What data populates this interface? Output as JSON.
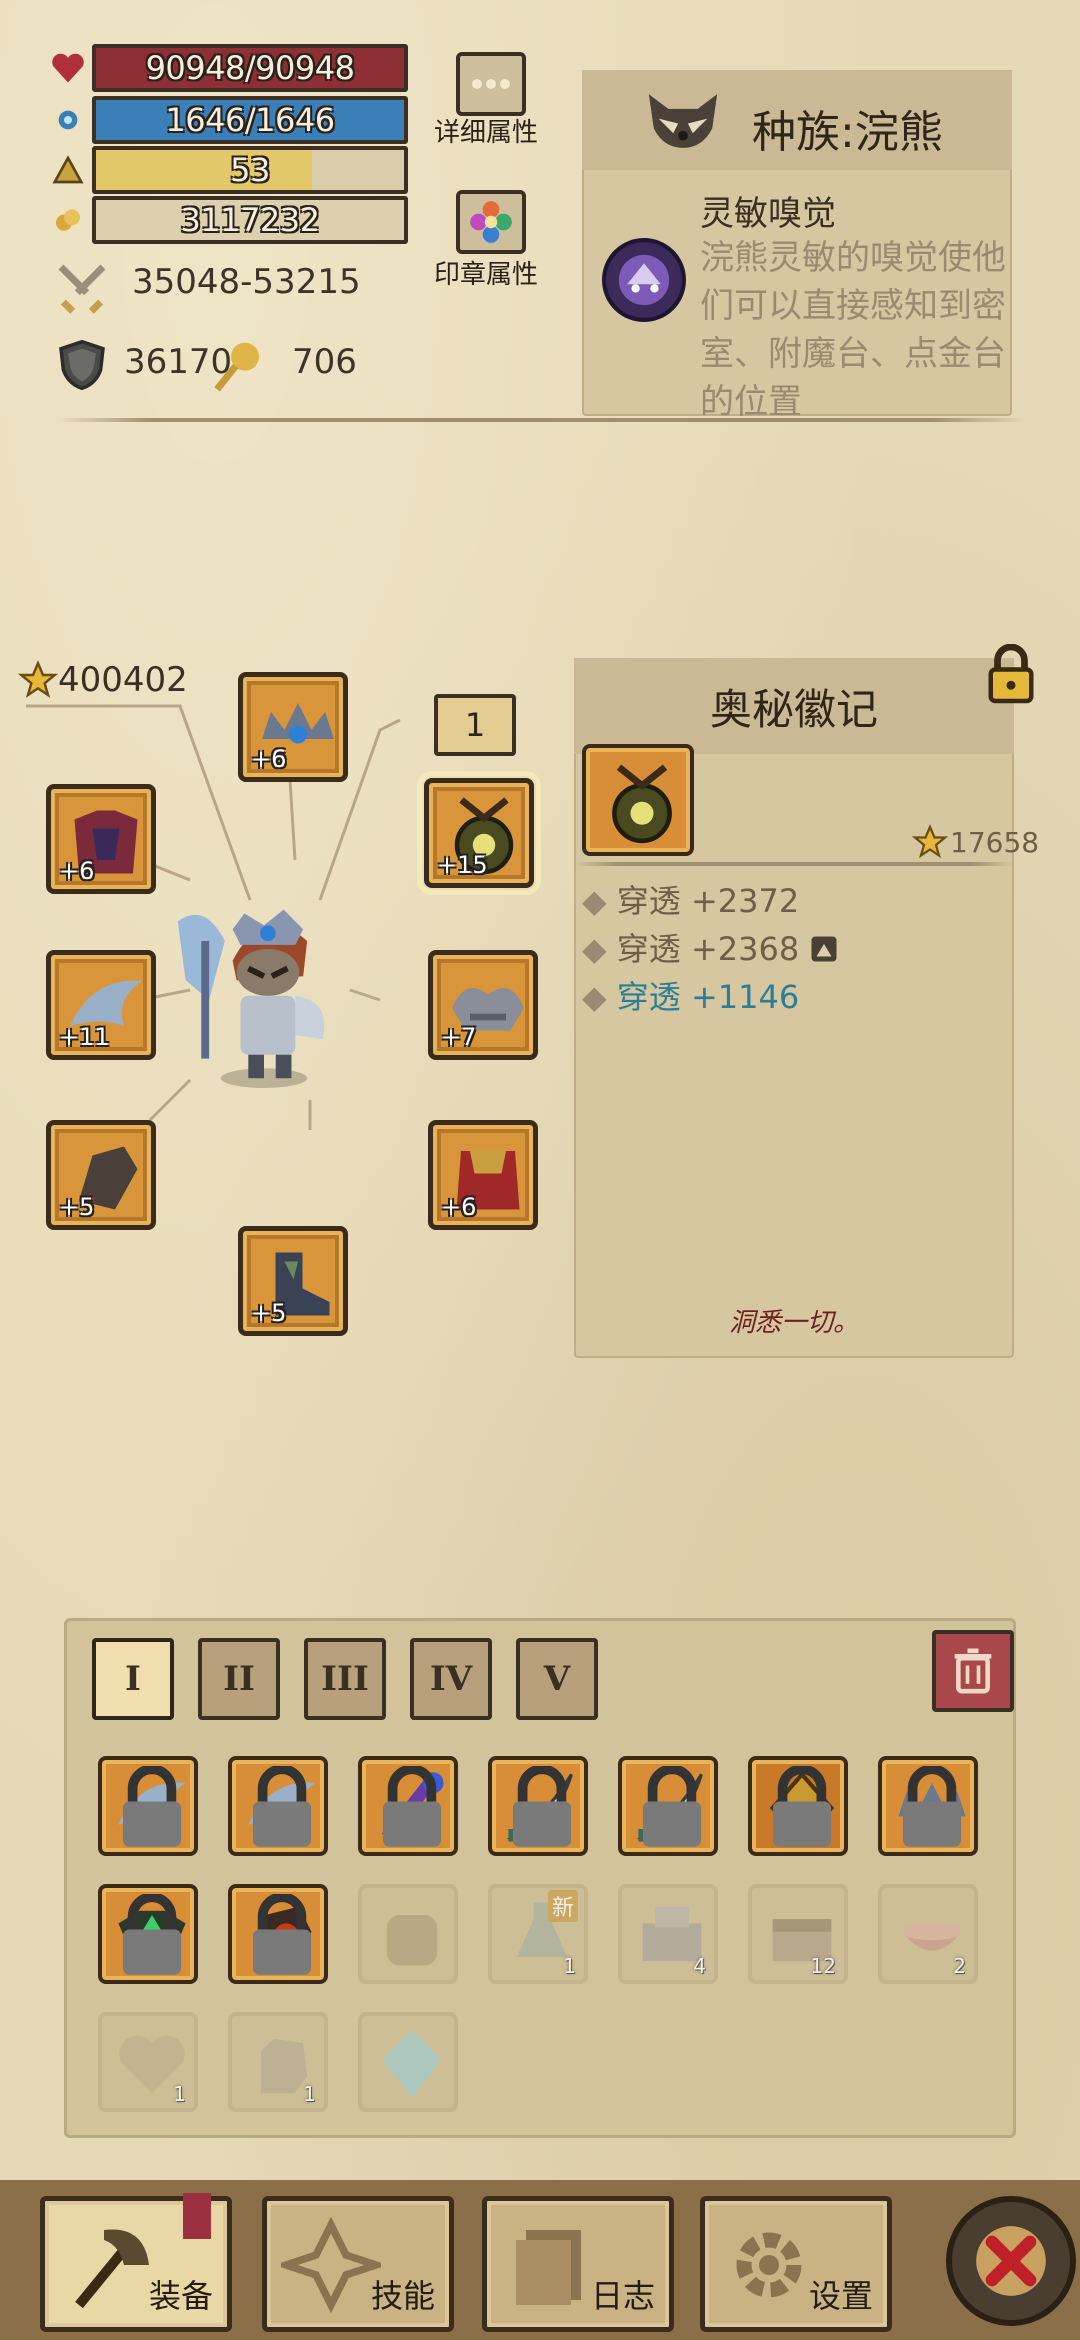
{
  "stats": {
    "hp": "90948/90948",
    "mp": "1646/1646",
    "level": "53",
    "gold": "3117232",
    "attack_range": "35048-53215",
    "defense": "36170",
    "gold_find": "706",
    "colors": {
      "hp": "#8e2f36",
      "mp": "#3b7fb8",
      "level": "#e3c86a"
    }
  },
  "buttons": {
    "detail_attributes": "详细属性",
    "seal_attributes": "印章属性"
  },
  "race": {
    "title": "种族:浣熊",
    "talent_name": "灵敏嗅觉",
    "talent_desc": "浣熊灵敏的嗅觉使他们可以直接感知到密室、附魔台、点金台的位置"
  },
  "equipment": {
    "power": "400402",
    "slot_index": "1",
    "slots": [
      {
        "name": "helmet",
        "level": "+6"
      },
      {
        "name": "amulet",
        "level": "+15"
      },
      {
        "name": "chest",
        "level": "+6"
      },
      {
        "name": "shoulder",
        "level": "+7"
      },
      {
        "name": "offhand",
        "level": "+11"
      },
      {
        "name": "gloves",
        "level": "+5"
      },
      {
        "name": "cape",
        "level": "+6"
      },
      {
        "name": "boots",
        "level": "+5"
      }
    ]
  },
  "item_detail": {
    "title": "奥秘徽记",
    "score": "17658",
    "attributes": [
      {
        "name": "穿透",
        "value": "+2372"
      },
      {
        "name": "穿透",
        "value": "+2368"
      },
      {
        "name": "穿透",
        "value": "+1146"
      }
    ],
    "quote": "洞悉一切。"
  },
  "inventory": {
    "tabs": [
      "I",
      "II",
      "III",
      "IV",
      "V"
    ],
    "new_badge": "新",
    "counts": [
      "1",
      "4",
      "12",
      "2",
      "1",
      "1"
    ]
  },
  "nav": {
    "equipment": "装备",
    "skills": "技能",
    "journal": "日志",
    "settings": "设置"
  }
}
